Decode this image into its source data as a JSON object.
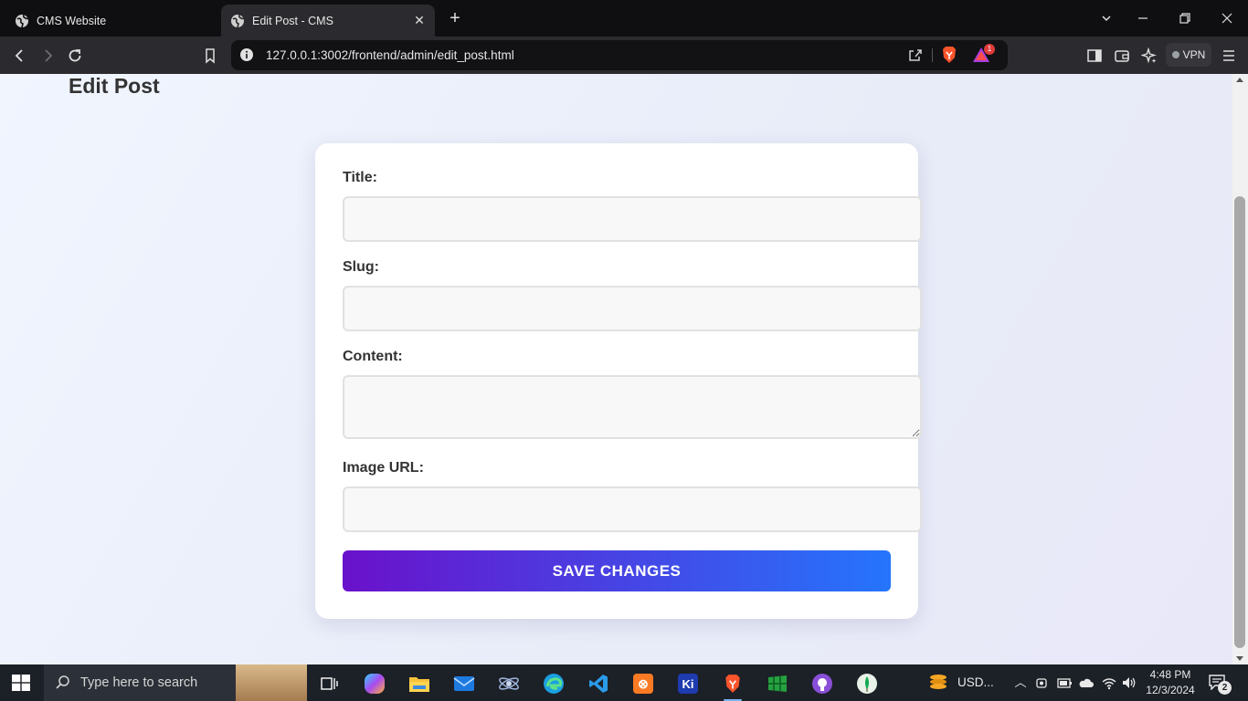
{
  "browser": {
    "tabs": [
      {
        "title": "CMS Website",
        "active": false
      },
      {
        "title": "Edit Post - CMS",
        "active": true
      }
    ],
    "url": "127.0.0.1:3002/frontend/admin/edit_post.html",
    "vpn_label": "VPN",
    "rewards_badge": "1"
  },
  "page": {
    "heading": "Edit Post",
    "form": {
      "title_label": "Title:",
      "title_value": "",
      "slug_label": "Slug:",
      "slug_value": "",
      "content_label": "Content:",
      "content_value": "",
      "image_label": "Image URL:",
      "image_value": "",
      "save_label": "SAVE CHANGES"
    }
  },
  "taskbar": {
    "search_placeholder": "Type here to search",
    "widget_text": "USD...",
    "time": "4:48 PM",
    "date": "12/3/2024",
    "notification_count": "2"
  },
  "colors": {
    "button_gradient_start": "#6a11cb",
    "button_gradient_end": "#2575fc",
    "page_background": "#eef1fb"
  }
}
